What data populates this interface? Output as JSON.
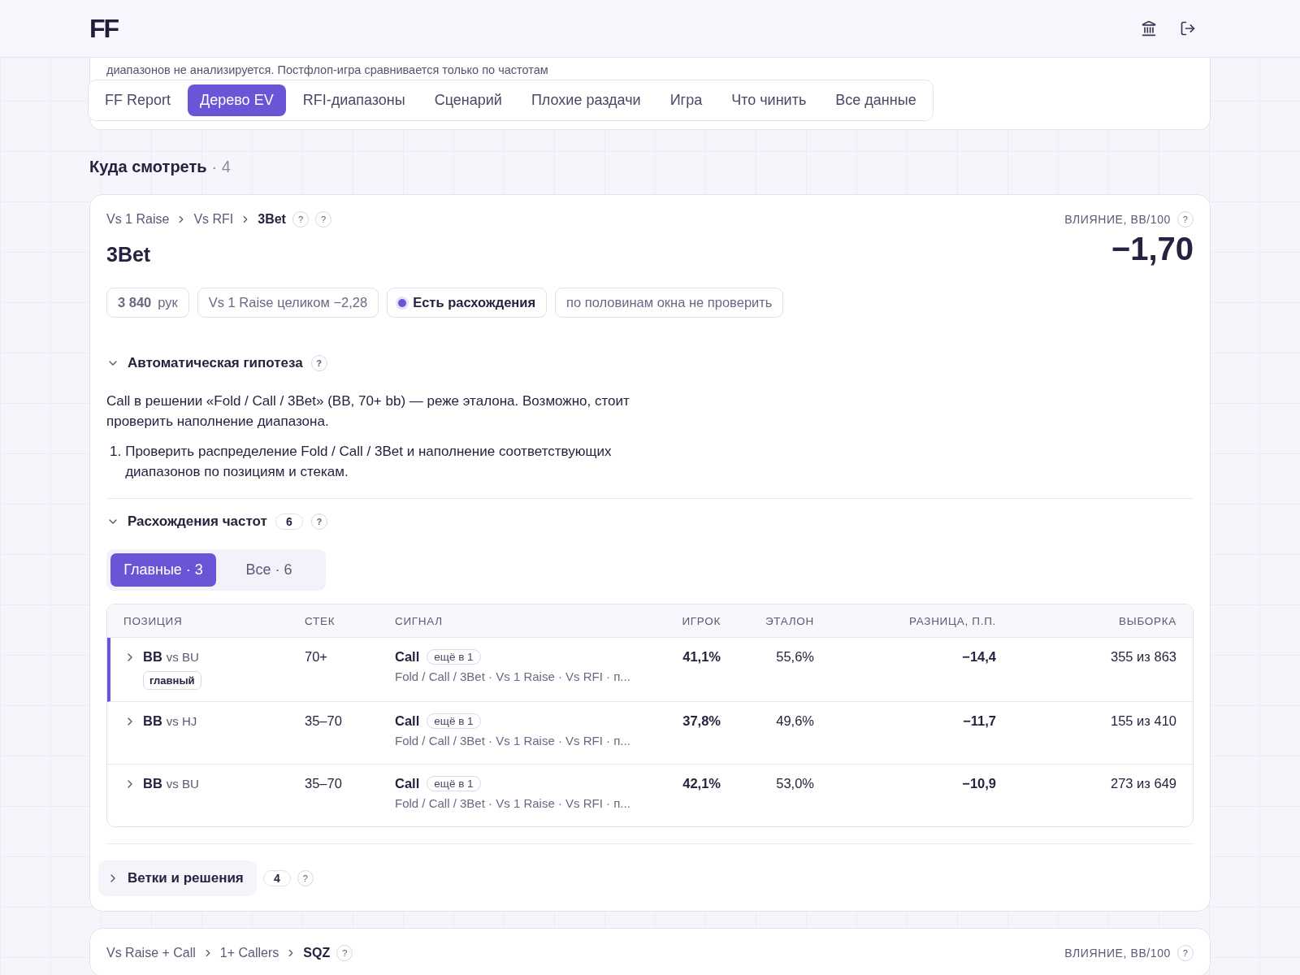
{
  "header": {
    "logo": "FF"
  },
  "intro": {
    "text": "диапазонов не анализируется. Постфлоп-игра сравнивается только по частотам"
  },
  "tabs": [
    {
      "label": "FF Report",
      "selected": false
    },
    {
      "label": "Дерево EV",
      "selected": true
    },
    {
      "label": "RFI-диапазоны",
      "selected": false
    },
    {
      "label": "Сценарий",
      "selected": false
    },
    {
      "label": "Плохие раздачи",
      "selected": false
    },
    {
      "label": "Игра",
      "selected": false
    },
    {
      "label": "Что чинить",
      "selected": false
    },
    {
      "label": "Все данные",
      "selected": false
    }
  ],
  "section": {
    "title": "Куда смотреть",
    "count": "· 4"
  },
  "cards": [
    {
      "breadcrumb": [
        "Vs 1 Raise",
        "Vs RFI",
        "3Bet"
      ],
      "breadcrumb_hints": [
        "?",
        "?"
      ],
      "impact_label": "ВЛИЯНИЕ, BB/100",
      "impact_hint": "?",
      "impact": "−1,70",
      "title": "3Bet",
      "chips": [
        {
          "kind": "count",
          "text": "**3 840** рук"
        },
        {
          "kind": "plain",
          "text": "Vs 1 Raise целиком −2,28"
        },
        {
          "kind": "status",
          "text": "Есть расхождения",
          "color": "#6b54d6"
        },
        {
          "kind": "plain",
          "text": "по половинам окна не проверить"
        }
      ],
      "hypothesis": {
        "title": "Автоматическая гипотеза",
        "hint": "?",
        "expanded": true,
        "text": "Call в решении «Fold / Call / 3Bet» (BB, 70+ bb) — реже эталона. Возможно, стоит проверить наполнение диапазона.",
        "steps": [
          {
            "marker": "1.",
            "text": "Проверить распределение Fold / Call / 3Bet и наполнение соответствующих диапазонов по позициям и стекам."
          }
        ]
      },
      "diffs": {
        "title": "Расхождения частот",
        "count": "6",
        "hint": "?",
        "expanded": true,
        "filters": [
          {
            "label": "Главные · 3",
            "selected": true
          },
          {
            "label": "Все · 6",
            "selected": false
          }
        ],
        "columns": [
          "ПОЗИЦИЯ",
          "СТЕК",
          "СИГНАЛ",
          "ИГРОК",
          "ЭТАЛОН",
          "РАЗНИЦА, П.П.",
          "ВЫБОРКА"
        ],
        "rows": [
          {
            "position": "BB",
            "versus": "vs BU",
            "tag": "главный",
            "highlighted": true,
            "expanded": false,
            "stack": "70+",
            "signal": "Call",
            "signal_tag": "ещё в 1",
            "path": "Fold / Call / 3Bet · Vs 1 Raise · Vs RFI · п...",
            "player": "41,1%",
            "reference": "55,6%",
            "diff": "−14,4",
            "sample": "355 из 863"
          },
          {
            "position": "BB",
            "versus": "vs HJ",
            "highlighted": false,
            "expanded": false,
            "stack": "35–70",
            "signal": "Call",
            "signal_tag": "ещё в 1",
            "path": "Fold / Call / 3Bet · Vs 1 Raise · Vs RFI · п...",
            "player": "37,8%",
            "reference": "49,6%",
            "diff": "−11,7",
            "sample": "155 из 410"
          },
          {
            "position": "BB",
            "versus": "vs BU",
            "highlighted": false,
            "expanded": false,
            "stack": "35–70",
            "signal": "Call",
            "signal_tag": "ещё в 1",
            "path": "Fold / Call / 3Bet · Vs 1 Raise · Vs RFI · п...",
            "player": "42,1%",
            "reference": "53,0%",
            "diff": "−10,9",
            "sample": "273 из 649"
          }
        ]
      },
      "branches": {
        "title": "Ветки и решения",
        "count": "4",
        "hint": "?",
        "expanded": false
      }
    },
    {
      "breadcrumb": [
        "Vs Raise + Call",
        "1+ Callers",
        "SQZ"
      ],
      "breadcrumb_hints": [
        "?"
      ],
      "impact_label": "ВЛИЯНИЕ, BB/100",
      "impact_hint": "?"
    }
  ]
}
